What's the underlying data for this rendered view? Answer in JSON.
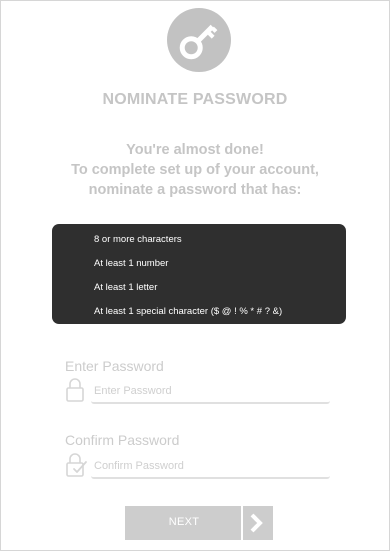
{
  "header": {
    "icon": "key-icon",
    "title": "NOMINATE PASSWORD"
  },
  "intro": {
    "line1": "You're almost done!",
    "line2": "To complete set up of your account,",
    "line3": "nominate a password that has:"
  },
  "requirements": [
    "8 or more characters",
    "At least 1 number",
    "At least 1 letter",
    "At least 1 special character ($ @ ! % * # ? &)"
  ],
  "password_field": {
    "label": "Enter Password",
    "placeholder": "Enter Password",
    "value": "",
    "icon": "padlock-icon"
  },
  "confirm_field": {
    "label": "Confirm Password",
    "placeholder": "Confirm Password",
    "value": "",
    "icon": "padlock-check-icon"
  },
  "next_button": {
    "label": "NEXT",
    "icon": "chevron-right-icon"
  },
  "colors": {
    "icon_circle": "#c2c2c2",
    "heading_text": "#c5c5c5",
    "requirements_bg": "#2f2f2f",
    "requirements_text": "#ffffff",
    "button_bg": "#cdcdcd",
    "input_underline": "#e0e0e0"
  }
}
